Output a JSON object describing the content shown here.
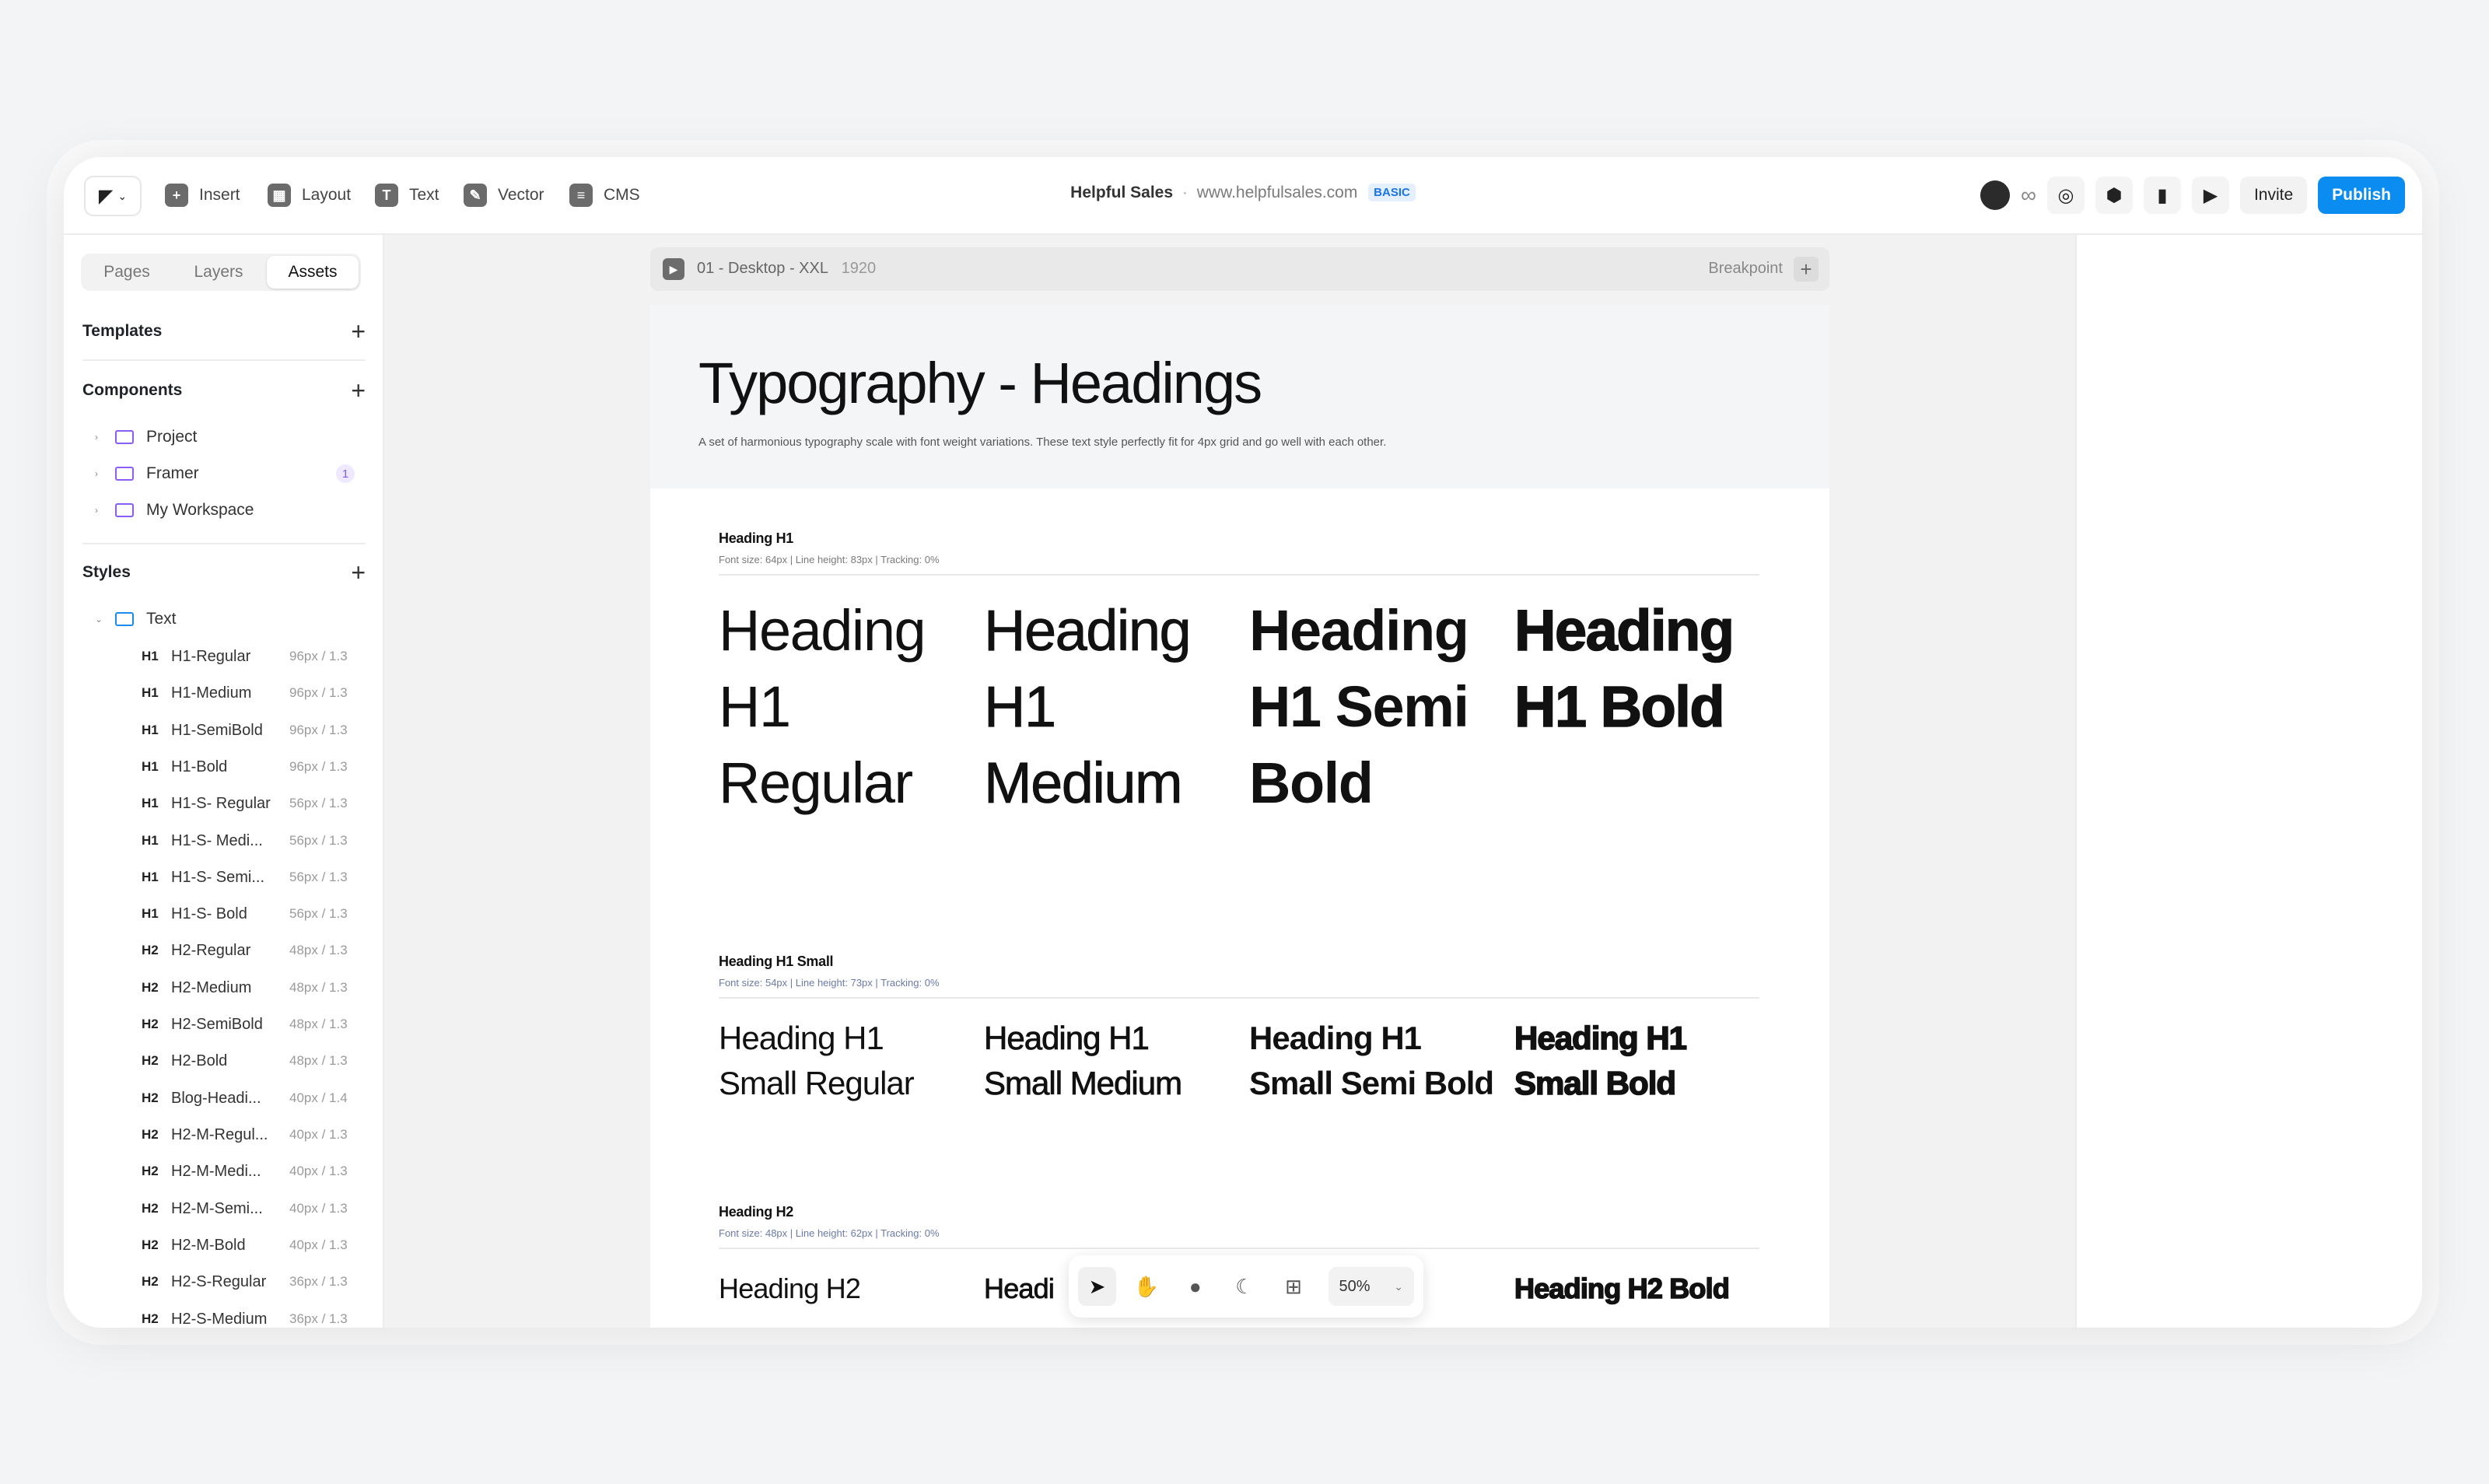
{
  "toolbar": {
    "insert": "Insert",
    "layout": "Layout",
    "text": "Text",
    "vector": "Vector",
    "cms": "CMS"
  },
  "project": {
    "name": "Helpful Sales",
    "separator": "·",
    "site": "www.helpfulsales.com",
    "plan": "BASIC"
  },
  "actions": {
    "invite": "Invite",
    "publish": "Publish"
  },
  "sidebar": {
    "tabs": [
      "Pages",
      "Layers",
      "Assets"
    ],
    "active_tab": "Assets",
    "templates": "Templates",
    "components": "Components",
    "folders": [
      {
        "label": "Project",
        "count": ""
      },
      {
        "label": "Framer",
        "count": "1"
      },
      {
        "label": "My Workspace",
        "count": ""
      }
    ],
    "styles": "Styles",
    "text_folder": "Text",
    "text_styles": [
      {
        "tag": "H1",
        "name": "H1-Regular",
        "meta": "96px / 1.3"
      },
      {
        "tag": "H1",
        "name": "H1-Medium",
        "meta": "96px / 1.3"
      },
      {
        "tag": "H1",
        "name": "H1-SemiBold",
        "meta": "96px / 1.3"
      },
      {
        "tag": "H1",
        "name": "H1-Bold",
        "meta": "96px / 1.3"
      },
      {
        "tag": "H1",
        "name": "H1-S- Regular",
        "meta": "56px / 1.3"
      },
      {
        "tag": "H1",
        "name": "H1-S- Medi...",
        "meta": "56px / 1.3"
      },
      {
        "tag": "H1",
        "name": "H1-S- Semi...",
        "meta": "56px / 1.3"
      },
      {
        "tag": "H1",
        "name": "H1-S- Bold",
        "meta": "56px / 1.3"
      },
      {
        "tag": "H2",
        "name": "H2-Regular",
        "meta": "48px / 1.3"
      },
      {
        "tag": "H2",
        "name": "H2-Medium",
        "meta": "48px / 1.3"
      },
      {
        "tag": "H2",
        "name": "H2-SemiBold",
        "meta": "48px / 1.3"
      },
      {
        "tag": "H2",
        "name": "H2-Bold",
        "meta": "48px / 1.3"
      },
      {
        "tag": "H2",
        "name": "Blog-Headi...",
        "meta": "40px / 1.4"
      },
      {
        "tag": "H2",
        "name": "H2-M-Regul...",
        "meta": "40px / 1.3"
      },
      {
        "tag": "H2",
        "name": "H2-M-Medi...",
        "meta": "40px / 1.3"
      },
      {
        "tag": "H2",
        "name": "H2-M-Semi...",
        "meta": "40px / 1.3"
      },
      {
        "tag": "H2",
        "name": "H2-M-Bold",
        "meta": "40px / 1.3"
      },
      {
        "tag": "H2",
        "name": "H2-S-Regular",
        "meta": "36px / 1.3"
      },
      {
        "tag": "H2",
        "name": "H2-S-Medium",
        "meta": "36px / 1.3"
      }
    ]
  },
  "canvas": {
    "frame_name": "01 - Desktop - XXL",
    "frame_width": "1920",
    "breakpoint": "Breakpoint",
    "hero_title": "Typography - Headings",
    "hero_desc": "A set of harmonious typography scale with font weight variations. These text style perfectly fit for 4px grid and go well with each other.",
    "sections": [
      {
        "title": "Heading H1",
        "meta": "Font size: 64px | Line height: 83px | Tracking: 0%",
        "samples": [
          "Heading H1 Regular",
          "Heading H1 Medium",
          "Heading H1 Semi Bold",
          "Heading H1 Bold"
        ]
      },
      {
        "title": "Heading H1 Small",
        "meta": "Font size: 54px | Line height: 73px | Tracking: 0%",
        "samples": [
          "Heading H1 Small Regular",
          "Heading H1 Small Medium",
          "Heading H1 Small Semi Bold",
          "Heading H1 Small Bold"
        ]
      },
      {
        "title": "Heading H2",
        "meta": "Font size: 48px | Line height: 62px | Tracking: 0%",
        "samples": [
          "Heading H2",
          "Headi",
          "",
          "Heading H2 Bold"
        ]
      }
    ]
  },
  "bottom_toolbar": {
    "zoom": "50%",
    "icons": [
      "cursor-icon",
      "hand-icon",
      "comment-icon",
      "moon-icon",
      "components-icon"
    ]
  },
  "colors": {
    "accent": "#0a8cf0",
    "folder": "#8b5cf6"
  }
}
